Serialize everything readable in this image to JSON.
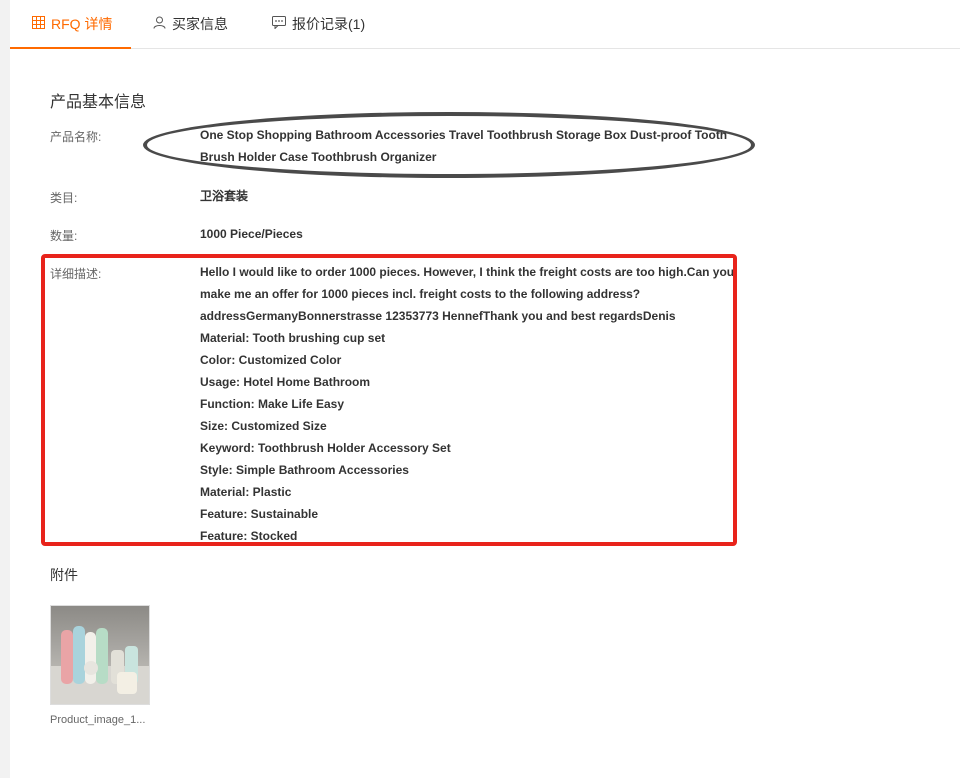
{
  "tabs": [
    {
      "label": "RFQ 详情",
      "icon": "table-icon",
      "active": true
    },
    {
      "label": "买家信息",
      "icon": "user-icon",
      "active": false
    },
    {
      "label": "报价记录(1)",
      "icon": "message-icon",
      "active": false
    }
  ],
  "colors": {
    "accent": "#ff6a00",
    "annotation_red": "#e8231b",
    "annotation_dark": "#4a4a4a"
  },
  "section": {
    "title": "产品基本信息"
  },
  "fields": {
    "name_label": "产品名称:",
    "name_value": "One Stop Shopping Bathroom Accessories Travel Toothbrush Storage Box Dust-proof Tooth Brush Holder Case Toothbrush Organizer",
    "category_label": "类目:",
    "category_value": "卫浴套装",
    "quantity_label": "数量:",
    "quantity_value": "1000 Piece/Pieces",
    "desc_label": "详细描述:"
  },
  "description_lines": [
    "Hello I would like to order 1000 pieces. However, I think the freight costs are too high.Can you",
    "make me an offer for 1000 pieces incl. freight costs to the following address?",
    "addressGermanyBonnerstrasse 12353773 HennefThank you and best regardsDenis",
    "Material: Tooth brushing cup set",
    "Color: Customized Color",
    "Usage: Hotel Home Bathroom",
    "Function: Make Life Easy",
    "Size: Customized Size",
    "Keyword: Toothbrush Holder Accessory Set",
    "Style: Simple Bathroom Accessories",
    "Material: Plastic",
    "Feature: Sustainable",
    "Feature: Stocked"
  ],
  "attachments": {
    "title": "附件",
    "files": [
      {
        "caption": "Product_image_1..."
      }
    ]
  }
}
